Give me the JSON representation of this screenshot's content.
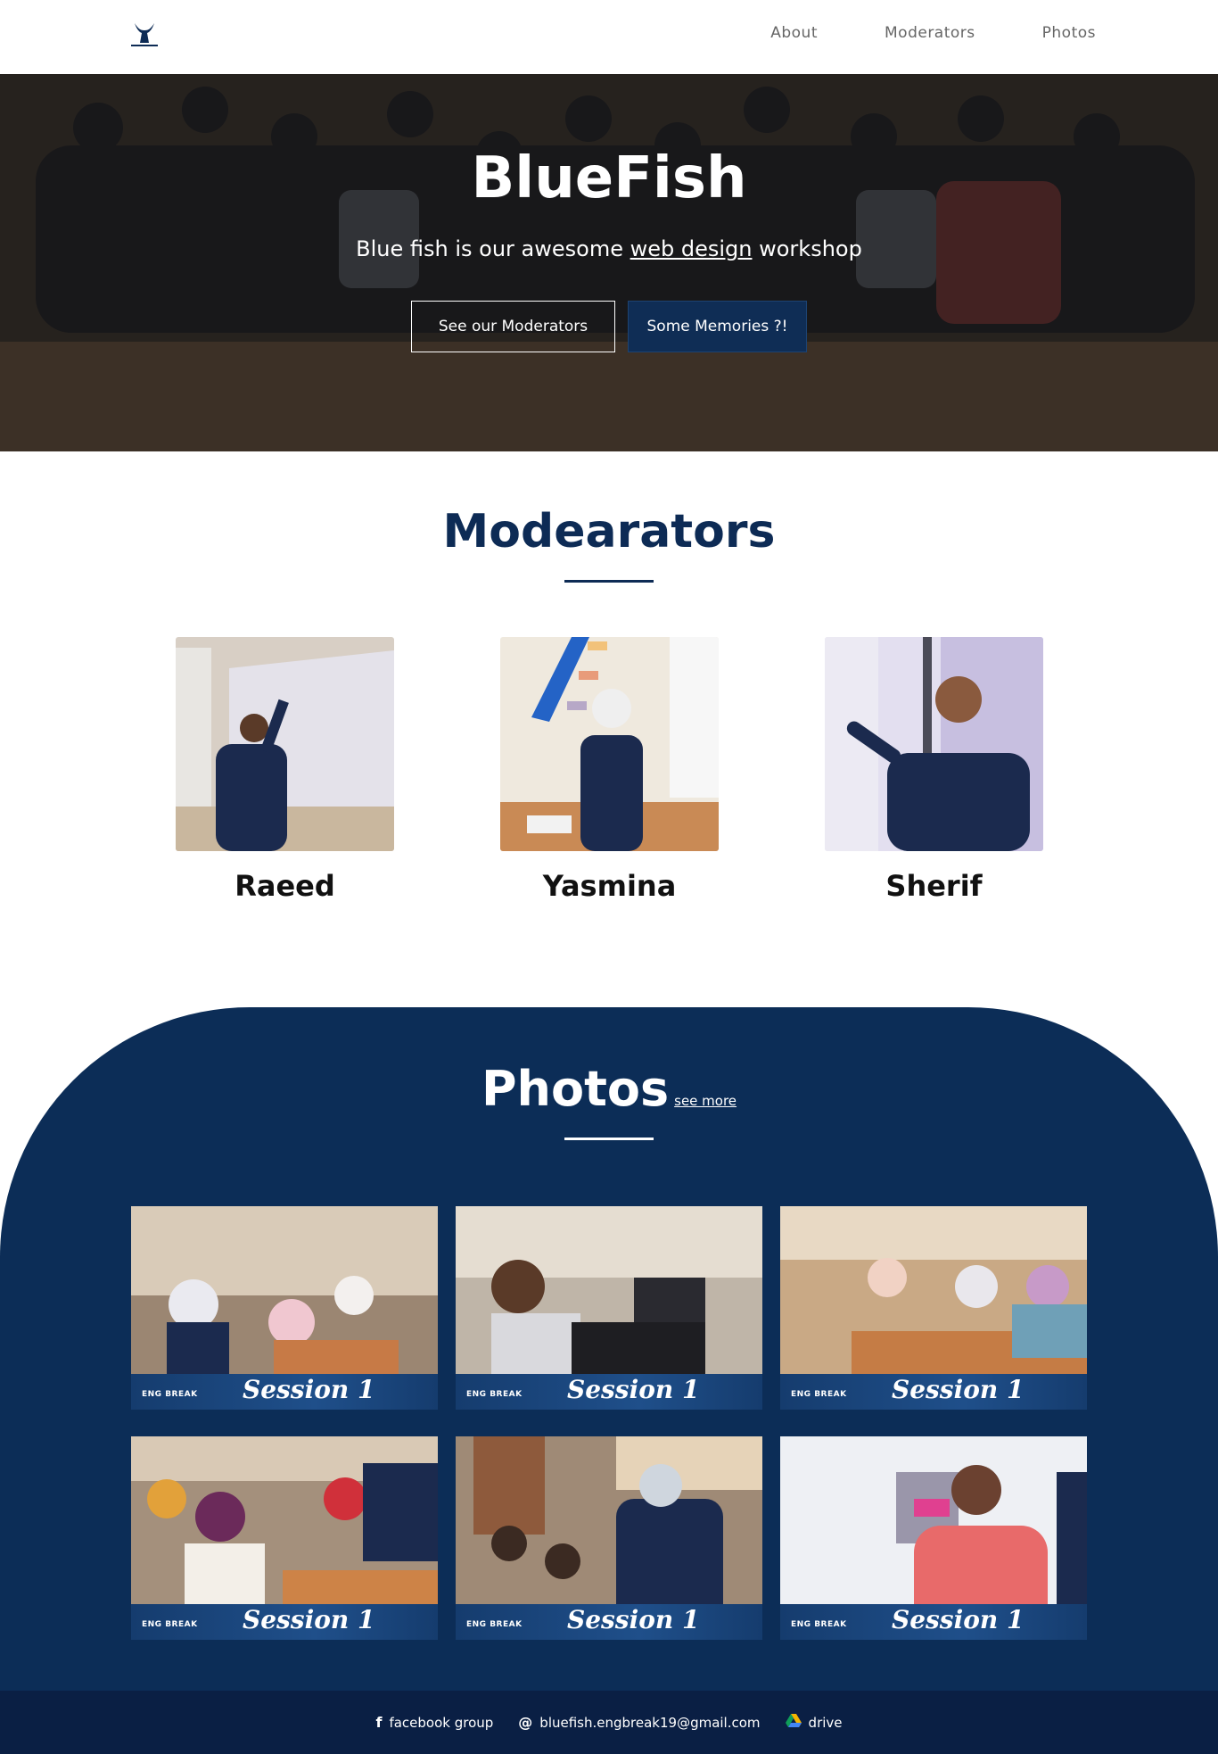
{
  "nav": {
    "logo_text": "BLUE FISH",
    "links": [
      "About",
      "Moderators",
      "Photos"
    ]
  },
  "hero": {
    "title": "BlueFish",
    "subtitle_pre": "Blue fish is our awesome ",
    "subtitle_link": "web design",
    "subtitle_post": " workshop",
    "btn_moderators": "See our Moderators",
    "btn_memories": "Some Memories ?!"
  },
  "moderators": {
    "title": "Modearators",
    "items": [
      {
        "name": "Raeed"
      },
      {
        "name": "Yasmina"
      },
      {
        "name": "Sherif"
      }
    ]
  },
  "photos": {
    "title": "Photos",
    "see_more": "see more",
    "tiles": [
      {
        "caption": "Session 1",
        "mark": "ENG BREAK"
      },
      {
        "caption": "Session 1",
        "mark": "ENG BREAK"
      },
      {
        "caption": "Session 1",
        "mark": "ENG BREAK"
      },
      {
        "caption": "Session 1",
        "mark": "ENG BREAK"
      },
      {
        "caption": "Session 1",
        "mark": "ENG BREAK"
      },
      {
        "caption": "Session 1",
        "mark": "ENG BREAK"
      }
    ]
  },
  "footer": {
    "facebook": "facebook group",
    "email": "bluefish.engbreak19@gmail.com",
    "drive": "drive"
  },
  "colors": {
    "navy": "#0d2b55",
    "footer": "#0a1f44",
    "button": "#0f2d55"
  }
}
